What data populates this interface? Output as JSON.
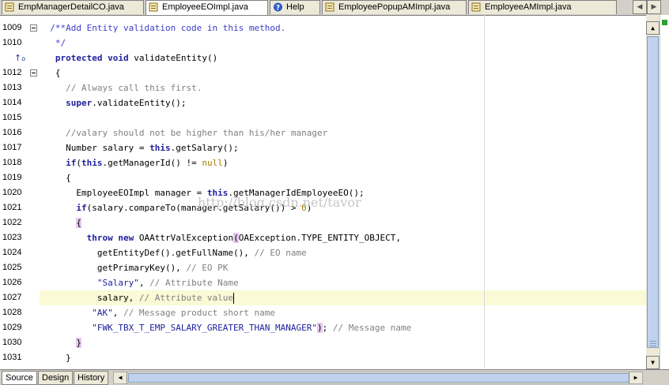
{
  "tabs": [
    {
      "label": "EmpManagerDetailCO.java",
      "icon": "java-file-icon",
      "active": false
    },
    {
      "label": "EmployeeEOImpl.java",
      "icon": "java-file-icon",
      "active": true
    },
    {
      "label": "Help",
      "icon": "help-icon",
      "active": false
    },
    {
      "label": "EmployeePopupAMImpl.java",
      "icon": "java-file-icon",
      "active": false
    },
    {
      "label": "EmployeeAMImpl.java",
      "icon": "java-file-icon",
      "active": false
    }
  ],
  "line_numbers": [
    "1009",
    "1010",
    "",
    "1012",
    "1013",
    "1014",
    "1015",
    "1016",
    "1017",
    "1018",
    "1019",
    "1020",
    "1021",
    "1022",
    "1023",
    "1024",
    "1025",
    "1026",
    "1027",
    "1028",
    "1029",
    "1030",
    "1031"
  ],
  "current_line": "1027",
  "watermark": "http://blog.csdn.net/tavor",
  "bottom_tabs": [
    "Source",
    "Design",
    "History"
  ],
  "colors": {
    "keyword": "#1e1e9c",
    "comment": "#808080",
    "string": "#1e1e9c",
    "current_line_bg": "#fafad7",
    "brace_match": "#e6c8f0"
  },
  "code": [
    [
      {
        "t": "  /**Add Entity validation code in this method.",
        "c": "jd"
      }
    ],
    [
      {
        "t": "   */",
        "c": "jd"
      }
    ],
    [
      {
        "t": "   "
      },
      {
        "t": "protected",
        "c": "kw"
      },
      {
        "t": " "
      },
      {
        "t": "void",
        "c": "kw"
      },
      {
        "t": " validateEntity()"
      }
    ],
    [
      {
        "t": "   {"
      }
    ],
    [
      {
        "t": "     "
      },
      {
        "t": "// Always call this first.",
        "c": "cm"
      }
    ],
    [
      {
        "t": "     "
      },
      {
        "t": "super",
        "c": "kw"
      },
      {
        "t": ".validateEntity();"
      }
    ],
    [
      {
        "t": ""
      }
    ],
    [
      {
        "t": "     "
      },
      {
        "t": "//valary should not be higher than his/her manager",
        "c": "cm"
      }
    ],
    [
      {
        "t": "     Number salary = "
      },
      {
        "t": "this",
        "c": "kw"
      },
      {
        "t": ".getSalary();"
      }
    ],
    [
      {
        "t": "     "
      },
      {
        "t": "if",
        "c": "kw"
      },
      {
        "t": "("
      },
      {
        "t": "this",
        "c": "kw"
      },
      {
        "t": ".getManagerId() != "
      },
      {
        "t": "null",
        "c": "nul"
      },
      {
        "t": ")"
      }
    ],
    [
      {
        "t": "     {"
      }
    ],
    [
      {
        "t": "       EmployeeEOImpl manager = "
      },
      {
        "t": "this",
        "c": "kw"
      },
      {
        "t": ".getManagerIdEmployeeEO();"
      }
    ],
    [
      {
        "t": "       "
      },
      {
        "t": "if",
        "c": "kw"
      },
      {
        "t": "(salary.compareTo(manager.getSalary()) > "
      },
      {
        "t": "0",
        "c": "num"
      },
      {
        "t": ")"
      }
    ],
    [
      {
        "t": "       "
      },
      {
        "t": "{",
        "c": "bm"
      }
    ],
    [
      {
        "t": "         "
      },
      {
        "t": "throw",
        "c": "kw"
      },
      {
        "t": " "
      },
      {
        "t": "new",
        "c": "kw"
      },
      {
        "t": " OAAttrValException"
      },
      {
        "t": "(",
        "c": "bm"
      },
      {
        "t": "OAException.TYPE_ENTITY_OBJECT,"
      }
    ],
    [
      {
        "t": "           getEntityDef().getFullName(), "
      },
      {
        "t": "// EO name",
        "c": "cm"
      }
    ],
    [
      {
        "t": "           getPrimaryKey(), "
      },
      {
        "t": "// EO PK",
        "c": "cm"
      }
    ],
    [
      {
        "t": "           "
      },
      {
        "t": "\"Salary\"",
        "c": "str"
      },
      {
        "t": ", "
      },
      {
        "t": "// Attribute Name",
        "c": "cm"
      }
    ],
    [
      {
        "t": "           salary, "
      },
      {
        "t": "// Attribute value",
        "c": "cm"
      },
      {
        "t": "",
        "c": "caret"
      }
    ],
    [
      {
        "t": "          "
      },
      {
        "t": "\"AK\"",
        "c": "str"
      },
      {
        "t": ", "
      },
      {
        "t": "// Message product short name",
        "c": "cm"
      }
    ],
    [
      {
        "t": "          "
      },
      {
        "t": "\"FWK_TBX_T_EMP_SALARY_GREATER_THAN_MANAGER\"",
        "c": "str"
      },
      {
        "t": ")",
        "c": "bm"
      },
      {
        "t": "; "
      },
      {
        "t": "// Message name",
        "c": "cm"
      }
    ],
    [
      {
        "t": "       "
      },
      {
        "t": "}",
        "c": "bm"
      }
    ],
    [
      {
        "t": "     }"
      }
    ]
  ]
}
